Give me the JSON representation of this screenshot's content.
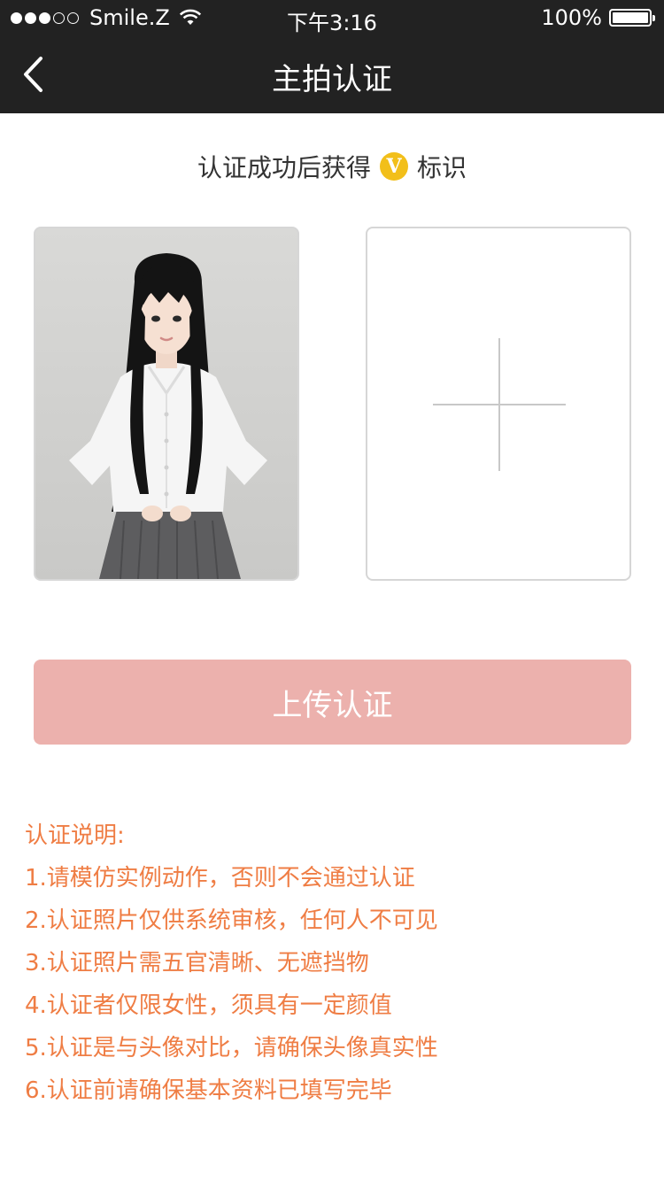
{
  "status_bar": {
    "carrier": "Smile.Z",
    "time": "下午3:16",
    "battery": "100%",
    "signal_bars": 3
  },
  "nav": {
    "title": "主拍认证",
    "back_icon": "chevron-left-icon"
  },
  "subtitle": {
    "before": "认证成功后获得",
    "badge": "V",
    "after": "标识",
    "badge_color": "#f2bf1a"
  },
  "upload": {
    "icon": "plus-icon"
  },
  "submit_button": {
    "label": "上传认证",
    "color": "#ecb1ad"
  },
  "notes": {
    "heading": "认证说明:",
    "items": [
      "1.请模仿实例动作，否则不会通过认证",
      "2.认证照片仅供系统审核，任何人不可见",
      "3.认证照片需五官清晰、无遮挡物",
      "4.认证者仅限女性，须具有一定颜值",
      "5.认证是与头像对比，请确保头像真实性",
      "6.认证前请确保基本资料已填写完毕"
    ],
    "color": "#ef7d44"
  },
  "colors": {
    "header_bg": "#222222"
  }
}
